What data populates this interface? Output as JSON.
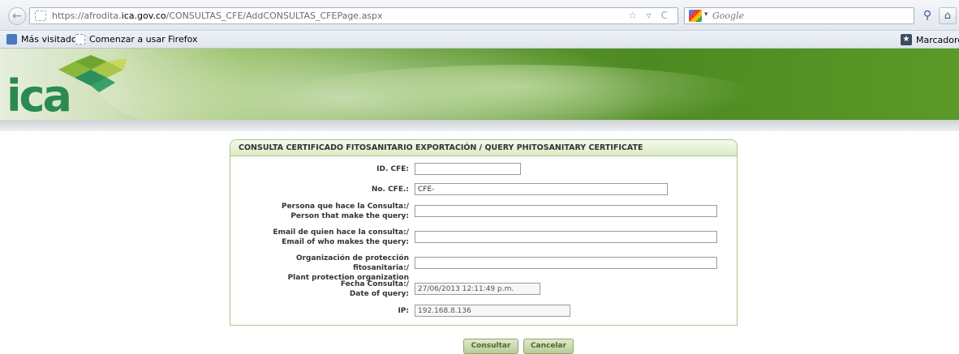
{
  "browser": {
    "url_prefix": "https://afrodita.",
    "url_domain": "ica.gov.co",
    "url_path": "/CONSULTAS_CFE/AddCONSULTAS_CFEPage.aspx",
    "url_icons": "☆ ▿ C",
    "search_placeholder": "Google",
    "bookmarks": [
      "Más visitados",
      "Comenzar a usar Firefox"
    ],
    "bookmarks_menu": "Marcadores"
  },
  "banner": {
    "logo": "ica"
  },
  "form": {
    "title": "CONSULTA CERTIFICADO FITOSANITARIO EXPORTACIÓN / QUERY PHITOSANITARY CERTIFICATE",
    "fields": [
      {
        "label1": "ID. CFE:",
        "label2": "",
        "value": ""
      },
      {
        "label1": "No. CFE.:",
        "label2": "",
        "value": "CFE-"
      },
      {
        "label1": "Persona que hace la Consulta:/",
        "label2": "Person that make the query:",
        "value": ""
      },
      {
        "label1": "Email de quien hace la consulta:/",
        "label2": "Email of who makes the query:",
        "value": ""
      },
      {
        "label1": "Organización de protección fitosanitaria:/",
        "label2": "Plant protection organization",
        "value": ""
      },
      {
        "label1": "Fecha Consulta:/",
        "label2": "Date of query:",
        "value": "27/06/2013 12:11:49 p.m."
      },
      {
        "label1": "IP:",
        "label2": "",
        "value": "192.168.8.136"
      }
    ],
    "buttons": {
      "submit": "Consultar",
      "cancel": "Cancelar"
    }
  },
  "colors": {
    "accent_green": "#4d8a21",
    "panel_border": "#a9c58f",
    "logo_green": "#2a8a52"
  }
}
